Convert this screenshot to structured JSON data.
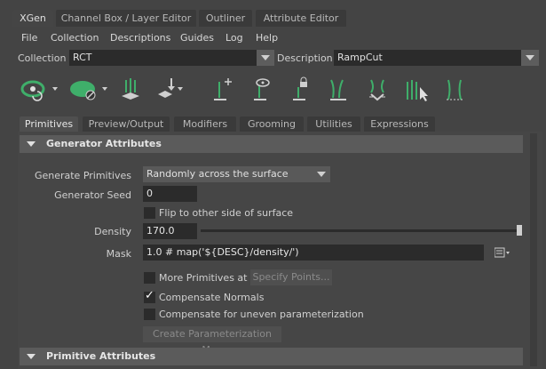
{
  "tabs": [
    "XGen",
    "Channel Box / Layer Editor",
    "Outliner",
    "Attribute Editor"
  ],
  "menu": [
    "File",
    "Collection",
    "Descriptions",
    "Guides",
    "Log",
    "Help"
  ],
  "collection": {
    "label": "Collection",
    "value": "RCT"
  },
  "description": {
    "label": "Description",
    "value": "RampCut"
  },
  "toolbar_icons": [
    "visibility-eye-icon",
    "preview-ellipse-icon",
    "guides-icon",
    "place-guides-icon",
    "add-guide-icon",
    "show-guide-icon",
    "lock-guide-icon",
    "guide-curves-icon",
    "sculpt-guides-icon",
    "select-guides-icon",
    "guide-cv-icon"
  ],
  "subtabs": [
    "Primitives",
    "Preview/Output",
    "Modifiers",
    "Grooming",
    "Utilities",
    "Expressions"
  ],
  "generator": {
    "title": "Generator Attributes",
    "generate_label": "Generate Primitives",
    "generate_value": "Randomly across the surface",
    "seed_label": "Generator Seed",
    "seed_value": "0",
    "flip_label": "Flip to other side of surface",
    "density_label": "Density",
    "density_value": "170.0",
    "mask_label": "Mask",
    "mask_value": "1.0 # map('${DESC}/density/')",
    "more_primitives_label": "More Primitives at",
    "specify_points_label": "Specify Points...",
    "compensate_normals_label": "Compensate Normals",
    "compensate_uneven_label": "Compensate for uneven parameterization",
    "create_param_map_label": "Create Parameterization Map"
  },
  "primitive_attributes": {
    "title": "Primitive Attributes"
  },
  "checkboxes": {
    "flip": false,
    "more_primitives": false,
    "compensate_normals": true,
    "compensate_uneven": false
  },
  "colors": {
    "accent": "#2f7a55",
    "green_icon": "#3fae6a"
  }
}
